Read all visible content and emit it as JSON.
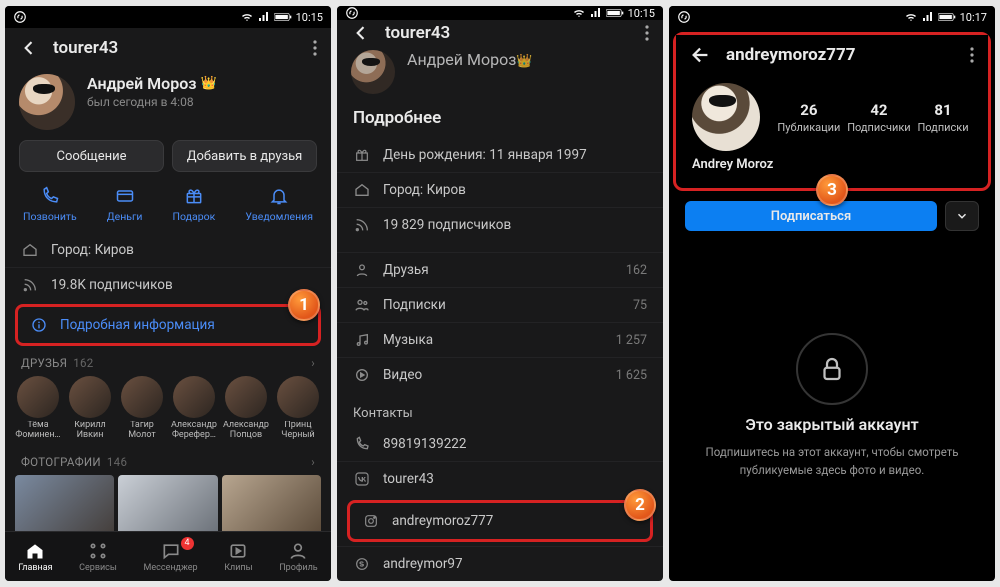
{
  "statusbar": {
    "time1": "10:15",
    "time2": "10:15",
    "time3": "10:17"
  },
  "p1": {
    "username": "tourer43",
    "name": "Андрей Мороз",
    "seen": "был сегодня в 4:08",
    "btn_msg": "Сообщение",
    "btn_add": "Добавить в друзья",
    "act_call": "Позвонить",
    "act_money": "Деньги",
    "act_gift": "Подарок",
    "act_notif": "Уведомления",
    "city_label": "Город:",
    "city_value": "Киров",
    "subs": "19.8K подписчиков",
    "detail": "Подробная информация",
    "friends_label": "ДРУЗЬЯ",
    "friends_count": "162",
    "friends": [
      "Тёма Фоминен…",
      "Кирилл Ивкин",
      "Тагир Молот",
      "Александр Ферефер…",
      "Александр Попцов",
      "Принц Черный"
    ],
    "photos_label": "ФОТОГРАФИИ",
    "photos_count": "146",
    "nav": {
      "home": "Главная",
      "services": "Сервисы",
      "msgr": "Мессенджер",
      "clips": "Клипы",
      "profile": "Профиль",
      "badge": "4"
    }
  },
  "p2": {
    "username": "tourer43",
    "name": "Андрей Мороз",
    "title": "Подробнее",
    "bday_label": "День рождения:",
    "bday_value": "11 января 1997",
    "city_label": "Город:",
    "city_value": "Киров",
    "subs": "19 829 подписчиков",
    "friends_label": "Друзья",
    "friends_value": "162",
    "follow_label": "Подписки",
    "follow_value": "75",
    "music_label": "Музыка",
    "music_value": "1 257",
    "video_label": "Видео",
    "video_value": "1 625",
    "contacts_label": "Контакты",
    "c_phone": "89819139222",
    "c_vk": "tourer43",
    "c_ig": "andreymoroz777",
    "c_skype": "andreymor97"
  },
  "p3": {
    "username": "andreymoroz777",
    "stats": {
      "posts_n": "26",
      "posts_l": "Публикации",
      "followers_n": "42",
      "followers_l": "Подписчики",
      "following_n": "81",
      "following_l": "Подписки"
    },
    "display_name": "Andrey Moroz",
    "subscribe": "Подписаться",
    "private_h": "Это закрытый аккаунт",
    "private_s": "Подпишитесь на этот аккаунт, чтобы смотреть публикуемые здесь фото и видео."
  }
}
